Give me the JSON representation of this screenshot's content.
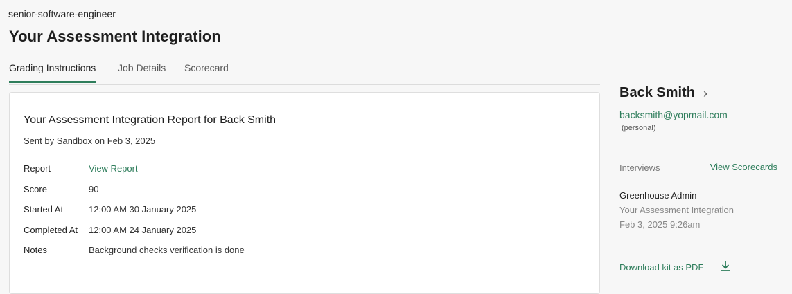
{
  "header": {
    "slug": "senior-software-engineer",
    "title": "Your Assessment Integration"
  },
  "tabs": [
    {
      "label": "Grading Instructions",
      "active": true
    },
    {
      "label": "Job Details",
      "active": false
    },
    {
      "label": "Scorecard",
      "active": false
    }
  ],
  "report": {
    "title": "Your Assessment Integration Report for Back Smith",
    "sent_by": "Sent by Sandbox on Feb 3, 2025",
    "fields": [
      {
        "label": "Report",
        "value": "View Report"
      },
      {
        "label": "Score",
        "value": "90"
      },
      {
        "label": "Started At",
        "value": "12:00 AM 30 January 2025"
      },
      {
        "label": "Completed At",
        "value": "12:00 AM 24 January 2025"
      },
      {
        "label": "Notes",
        "value": "Background checks verification is done"
      }
    ]
  },
  "sidebar": {
    "candidate_name": "Back Smith",
    "chevron": "›",
    "email": "backsmith@yopmail.com",
    "email_type": "(personal)",
    "interviews_label": "Interviews",
    "view_scorecards_label": "View Scorecards",
    "interview": {
      "interviewer": "Greenhouse Admin",
      "name": "Your Assessment Integration",
      "date": "Feb 3, 2025 9:26am"
    },
    "download_label": "Download kit as PDF",
    "download_icon": "download-icon"
  },
  "colors": {
    "accent": "#2e7d5b",
    "background": "#f7f7f7",
    "card": "#ffffff"
  }
}
